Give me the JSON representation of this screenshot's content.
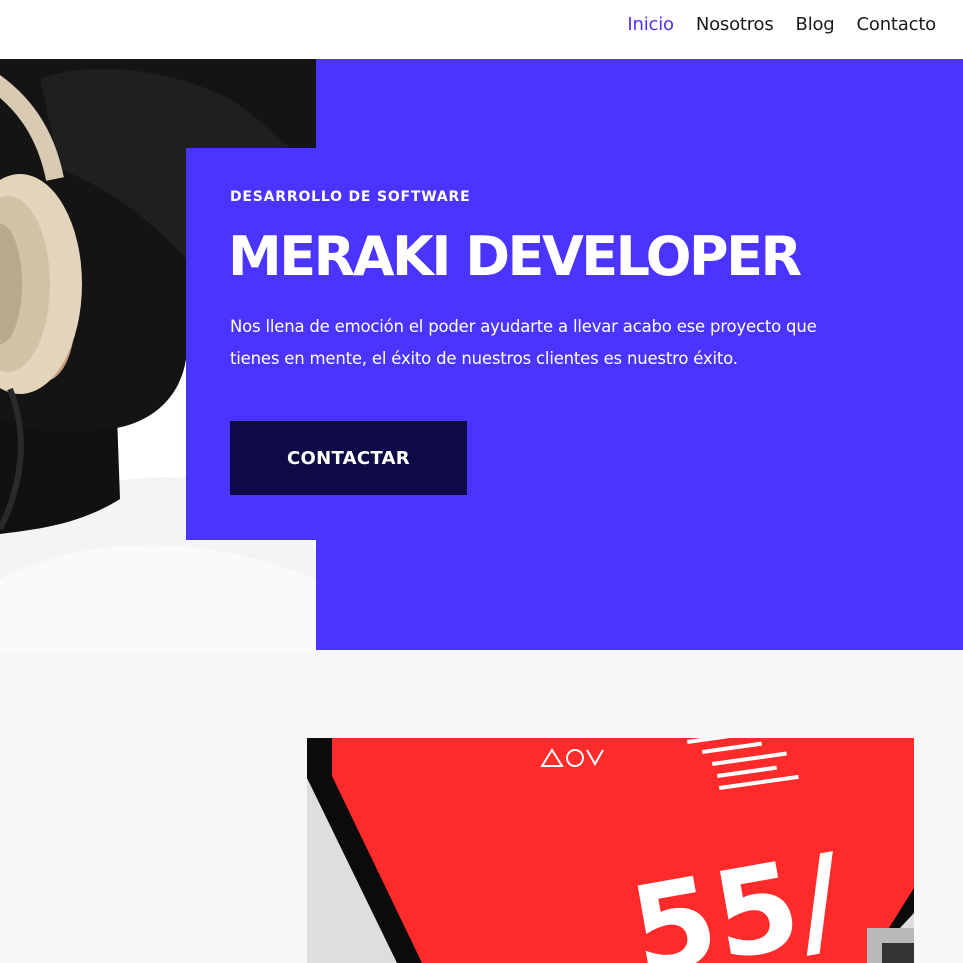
{
  "nav": {
    "items": [
      {
        "label": "Inicio",
        "active": true
      },
      {
        "label": "Nosotros",
        "active": false
      },
      {
        "label": "Blog",
        "active": false
      },
      {
        "label": "Contacto",
        "active": false
      }
    ]
  },
  "hero": {
    "eyebrow": "DESARROLLO DE SOFTWARE",
    "title": "MERAKI DEVELOPER",
    "description": "Nos llena de emoción el poder ayudarte a llevar acabo ese proyecto que tienes en mente, el éxito de nuestros clientes es nuestro éxito.",
    "cta_label": "CONTACTAR",
    "image": "person-with-headphones-photo"
  },
  "section2": {
    "image": "laptop-red-screen-photo",
    "screen_number": "55/"
  },
  "colors": {
    "accent": "#4b34ff",
    "button_dark": "#0e0a45",
    "section_bg": "#f7f7f7",
    "screen_red": "#ff2b2b"
  }
}
